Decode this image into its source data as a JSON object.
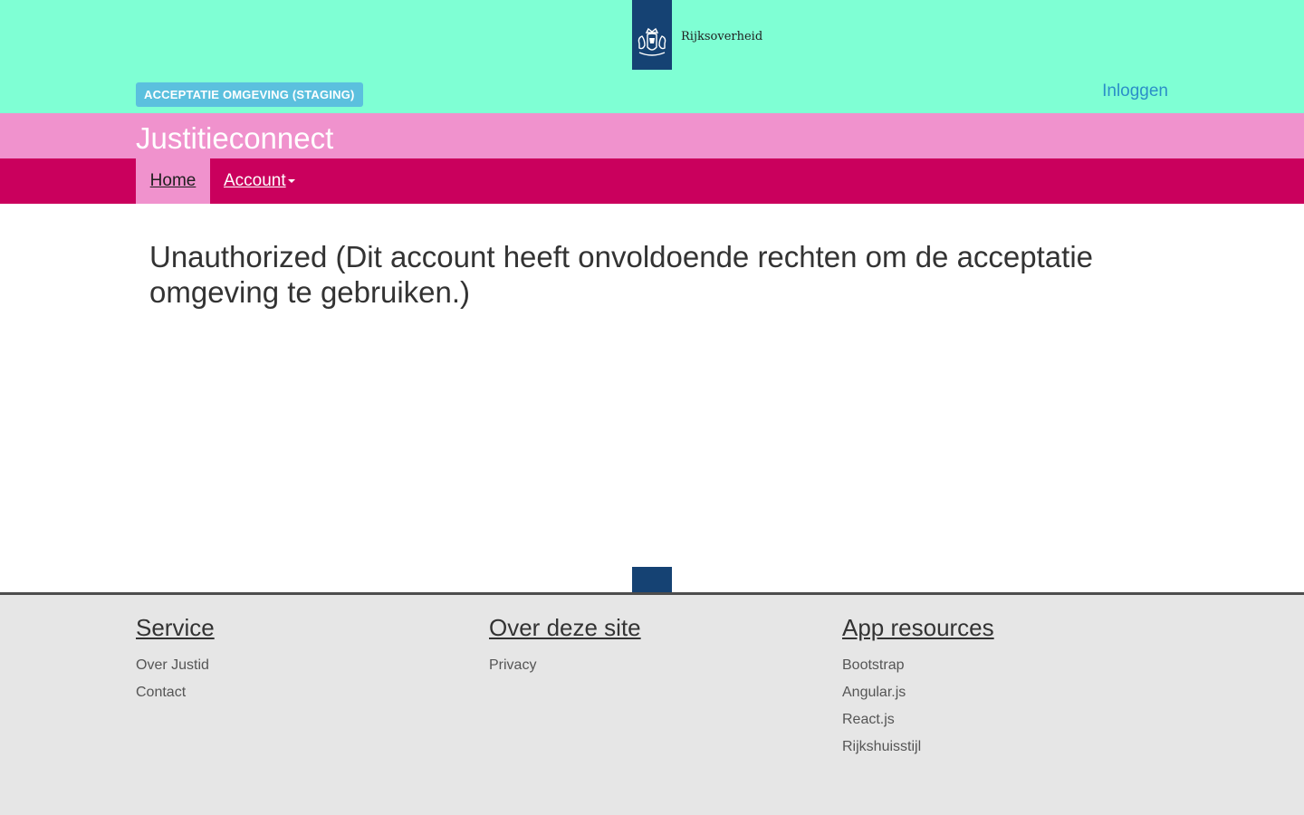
{
  "header": {
    "logo_text": "Rijksoverheid",
    "environment_badge": "ACCEPTATIE OMGEVING (STAGING)",
    "login_label": "Inloggen"
  },
  "brand": {
    "title": "Justitieconnect"
  },
  "nav": {
    "items": [
      {
        "label": "Home",
        "active": true
      },
      {
        "label": "Account",
        "has_dropdown": true
      }
    ]
  },
  "main": {
    "heading": "Unauthorized (Dit account heeft onvoldoende rechten om de acceptatie omgeving te gebruiken.)"
  },
  "footer": {
    "columns": [
      {
        "heading": "Service",
        "links": [
          "Over Justid",
          "Contact"
        ]
      },
      {
        "heading": "Over deze site",
        "links": [
          "Privacy"
        ]
      },
      {
        "heading": "App resources",
        "links": [
          "Bootstrap",
          "Angular.js",
          "React.js",
          "Rijkshuisstijl"
        ]
      }
    ]
  },
  "colors": {
    "top_band": "#7fffd4",
    "brand_band": "#f092cd",
    "nav_band": "#ca005d",
    "logo_blue": "#154273",
    "badge": "#5bc0de",
    "link": "#2b8fc8",
    "footer_bg": "#e6e6e6"
  },
  "icons": {
    "logo": "rijksoverheid-emblem-icon",
    "account_dropdown": "caret-down-icon"
  }
}
